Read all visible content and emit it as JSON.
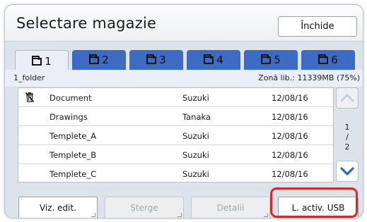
{
  "header": {
    "title": "Selectare magazie",
    "close_label": "Închide"
  },
  "tabs": [
    {
      "label": "1",
      "icon": "folder-icon",
      "active": true
    },
    {
      "label": "2",
      "icon": "folder-icon",
      "active": false
    },
    {
      "label": "3",
      "icon": "folder-icon",
      "active": false
    },
    {
      "label": "4",
      "icon": "folder-icon",
      "active": false
    },
    {
      "label": "5",
      "icon": "folder-icon",
      "active": false
    },
    {
      "label": "6",
      "icon": "folder-icon",
      "active": false
    }
  ],
  "status": {
    "folder_name": "1_folder",
    "free_space": "Zonă lib.: 11339MB (75%)"
  },
  "files": [
    {
      "name": "Document",
      "owner": "Suzuki",
      "date": "12/08/16",
      "icon": "trash-icon"
    },
    {
      "name": "Drawings",
      "owner": "Tanaka",
      "date": "12/08/16"
    },
    {
      "name": "Templete_A",
      "owner": "Suzuki",
      "date": "12/08/16"
    },
    {
      "name": "Templete_B",
      "owner": "Suzuki",
      "date": "12/08/16"
    },
    {
      "name": "Templete_C",
      "owner": "Suzuki",
      "date": "12/08/16"
    }
  ],
  "pager": {
    "current": "1",
    "separator": "/",
    "total": "2"
  },
  "footer": {
    "view_edit": "Viz. edit.",
    "delete": "Șterge",
    "details": "Detalii",
    "usb": "L. activ. USB"
  },
  "colors": {
    "tab": "#3d6bc4",
    "highlight": "#d8282c",
    "arrow": "#2f63c4"
  }
}
